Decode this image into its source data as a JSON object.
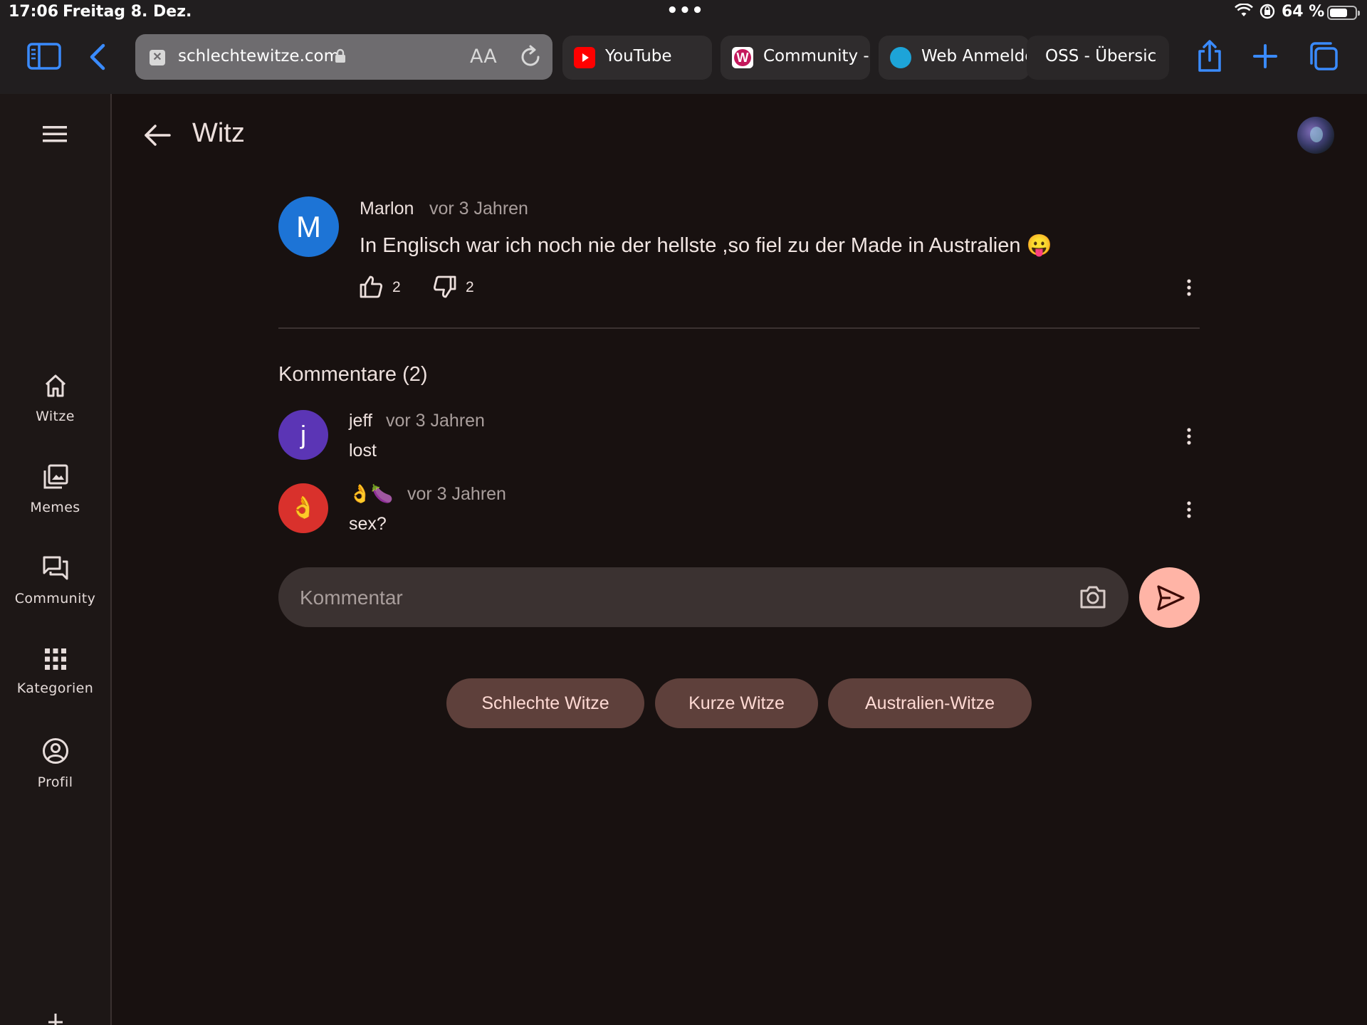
{
  "status_bar": {
    "time": "17:06",
    "date": "Freitag 8. Dez.",
    "battery": "64 %"
  },
  "browser": {
    "url": "schlechtewitze.com",
    "text_size_label": "AA",
    "tabs": [
      {
        "label": "YouTube"
      },
      {
        "label": "Community - I"
      },
      {
        "label": "Web Anmelde"
      },
      {
        "label": "OSS - Übersic"
      }
    ]
  },
  "sidebar": {
    "items": [
      {
        "label": "Witze",
        "icon": "home-icon"
      },
      {
        "label": "Memes",
        "icon": "image-icon"
      },
      {
        "label": "Community",
        "icon": "forum-icon"
      },
      {
        "label": "Kategorien",
        "icon": "apps-grid-icon"
      },
      {
        "label": "Profil",
        "icon": "account-circle-icon"
      }
    ]
  },
  "header": {
    "title": "Witz"
  },
  "post": {
    "avatar_letter": "M",
    "author": "Marlon",
    "time": "vor 3 Jahren",
    "text": "In Englisch war ich noch nie der hellste ,so fiel zu der Made in Australien 😛",
    "likes": "2",
    "dislikes": "2"
  },
  "comments": {
    "title": "Kommentare (2)",
    "items": [
      {
        "avatar": "j",
        "author": "jeff",
        "time": "vor 3 Jahren",
        "text": "lost"
      },
      {
        "avatar": "👌",
        "author": "👌🍆",
        "time": "vor 3 Jahren",
        "text": "sex?"
      }
    ]
  },
  "comment_input": {
    "placeholder": "Kommentar"
  },
  "tags": [
    "Schlechte Witze",
    "Kurze Witze",
    "Australien-Witze"
  ],
  "colors": {
    "background": "#181110",
    "accent": "#ffb4a6",
    "chip": "#5e403b",
    "post_avatar": "#1d74d6",
    "jeff_avatar": "#5b35b5",
    "emoji_avatar": "#d9312c"
  }
}
